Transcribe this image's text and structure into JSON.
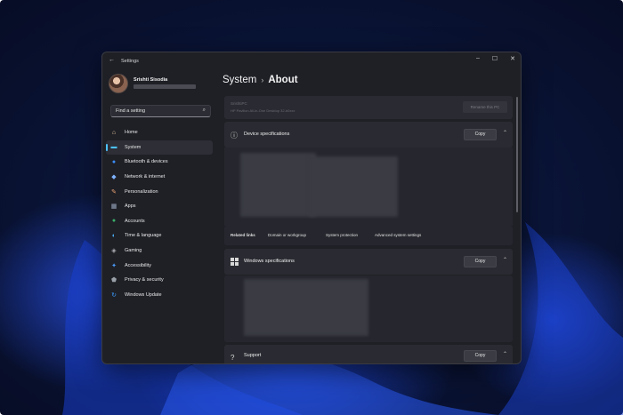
{
  "window": {
    "title": "Settings"
  },
  "profile": {
    "name": "Srishti Sisodia"
  },
  "search": {
    "placeholder": "Find a setting"
  },
  "sidebar": {
    "items": [
      {
        "label": "Home",
        "icon": "home-icon"
      },
      {
        "label": "System",
        "icon": "monitor-icon",
        "active": true
      },
      {
        "label": "Bluetooth & devices",
        "icon": "bluetooth-icon"
      },
      {
        "label": "Network & internet",
        "icon": "wifi-icon"
      },
      {
        "label": "Personalization",
        "icon": "brush-icon"
      },
      {
        "label": "Apps",
        "icon": "apps-icon"
      },
      {
        "label": "Accounts",
        "icon": "person-icon"
      },
      {
        "label": "Time & language",
        "icon": "globe-clock-icon"
      },
      {
        "label": "Gaming",
        "icon": "gamepad-icon"
      },
      {
        "label": "Accessibility",
        "icon": "accessibility-icon"
      },
      {
        "label": "Privacy & security",
        "icon": "shield-icon"
      },
      {
        "label": "Windows Update",
        "icon": "update-icon"
      }
    ]
  },
  "breadcrumb": {
    "parent": "System",
    "current": "About"
  },
  "pc": {
    "name": "SrishtiPC",
    "model": "HP Pavilion All-in-One Desktop 32-b0xxx",
    "rename_label": "Rename this PC"
  },
  "device_specs": {
    "title": "Device specifications",
    "copy_label": "Copy"
  },
  "related": {
    "title": "Related links",
    "links": [
      "Domain or workgroup",
      "System protection",
      "Advanced system settings"
    ]
  },
  "windows_specs": {
    "title": "Windows specifications",
    "copy_label": "Copy"
  },
  "support": {
    "title": "Support",
    "copy_label": "Copy"
  },
  "colors": {
    "accent": "#4cc2ff",
    "window_bg": "#1f2026",
    "card_bg": "#2a2b32"
  }
}
